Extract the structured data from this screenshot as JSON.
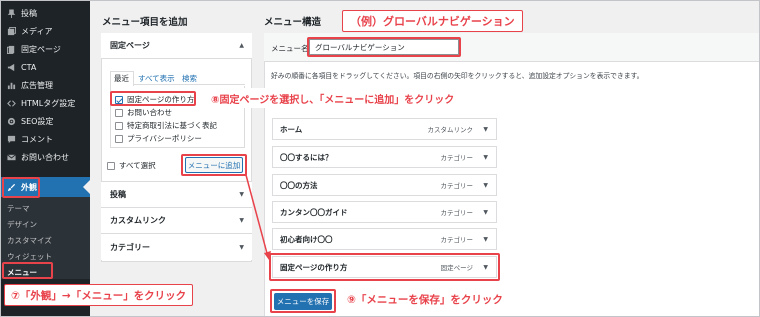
{
  "sidebar": {
    "items": [
      {
        "label": "投稿",
        "icon": "pin-icon"
      },
      {
        "label": "メディア",
        "icon": "media-icon"
      },
      {
        "label": "固定ページ",
        "icon": "pages-icon"
      },
      {
        "label": "CTA",
        "icon": "megaphone-icon"
      },
      {
        "label": "広告管理",
        "icon": "chart-icon"
      },
      {
        "label": "HTMLタグ設定",
        "icon": "code-icon"
      },
      {
        "label": "SEO設定",
        "icon": "gear-icon"
      },
      {
        "label": "コメント",
        "icon": "comment-icon"
      },
      {
        "label": "お問い合わせ",
        "icon": "mail-icon"
      }
    ],
    "active": {
      "label": "外観",
      "icon": "brush-icon"
    },
    "submenu": [
      "テーマ",
      "デザイン",
      "カスタマイズ",
      "ウィジェット",
      "メニュー"
    ]
  },
  "add_panel": {
    "title": "メニュー項目を追加",
    "pages_section": {
      "title": "固定ページ",
      "tabs": [
        "最近",
        "すべて表示",
        "検索"
      ],
      "pages": [
        {
          "label": "固定ページの作り方",
          "checked": true
        },
        {
          "label": "お問い合わせ",
          "checked": false
        },
        {
          "label": "特定商取引法に基づく表記",
          "checked": false
        },
        {
          "label": "プライバシーポリシー",
          "checked": false
        }
      ],
      "select_all": "すべて選択",
      "add_button": "メニューに追加"
    },
    "sections": [
      "投稿",
      "カスタムリンク",
      "カテゴリー"
    ]
  },
  "structure_panel": {
    "title": "メニュー構造",
    "menu_name_label": "メニュー名",
    "menu_name_value": "グローバルナビゲーション",
    "instruction": "好みの順番に各項目をドラッグしてください。項目の右側の矢印をクリックすると、追加設定オプションを表示できます。",
    "items": [
      {
        "label": "ホーム",
        "type": "カスタムリンク"
      },
      {
        "label": "〇〇するには？",
        "type": "カテゴリー"
      },
      {
        "label": "〇〇の方法",
        "type": "カテゴリー"
      },
      {
        "label": "カンタン〇〇ガイド",
        "type": "カテゴリー"
      },
      {
        "label": "初心者向け〇〇",
        "type": "カテゴリー"
      },
      {
        "label": "固定ページの作り方",
        "type": "固定ページ"
      }
    ],
    "save_button": "メニューを保存"
  },
  "callouts": {
    "menu_name": "（例）グローバルナビゲーション",
    "step8": "⑧固定ページを選択し、「メニューに追加」をクリック",
    "step7": "⑦「外観」→「メニュー」をクリック",
    "step9": "⑨「メニューを保存」をクリック"
  },
  "colors": {
    "sidebar_bg": "#1d2327",
    "accent": "#2271b1",
    "highlight": "#e8424b"
  }
}
